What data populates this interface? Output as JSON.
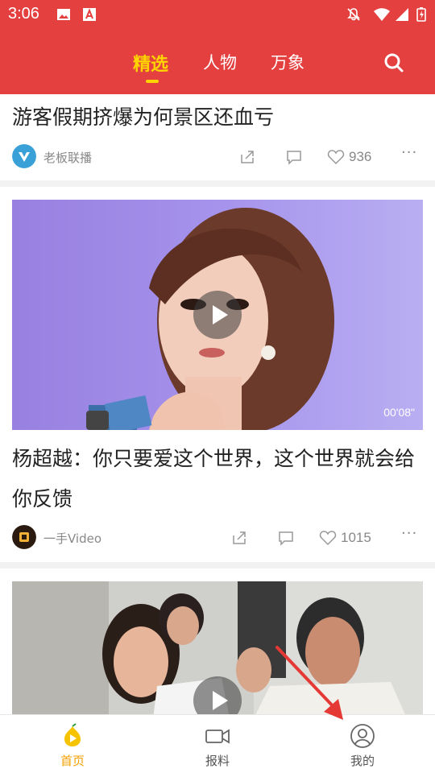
{
  "status_bar": {
    "time": "3:06"
  },
  "header": {
    "tabs": [
      {
        "label": "精选",
        "active": true
      },
      {
        "label": "人物",
        "active": false
      },
      {
        "label": "万象",
        "active": false
      }
    ],
    "search_icon": "search-icon",
    "colors": {
      "background": "#e4403f",
      "active_tab": "#ffd400"
    }
  },
  "feed": [
    {
      "title": "游客假期挤爆为何景区还血亏",
      "source": "老板联播",
      "likes": "936",
      "has_video": false
    },
    {
      "title": "杨超越：你只要爱这个世界，这个世界就会给你反馈",
      "source": "一手Video",
      "likes": "1015",
      "duration": "00'08\"",
      "has_video": true
    },
    {
      "has_video": true
    }
  ],
  "bottom_nav": [
    {
      "label": "首页",
      "icon": "home-icon",
      "active": true
    },
    {
      "label": "报料",
      "icon": "video-camera-icon",
      "active": false
    },
    {
      "label": "我的",
      "icon": "user-icon",
      "active": false
    }
  ],
  "colors": {
    "accent": "#f5a000",
    "arrow": "#e53935"
  }
}
